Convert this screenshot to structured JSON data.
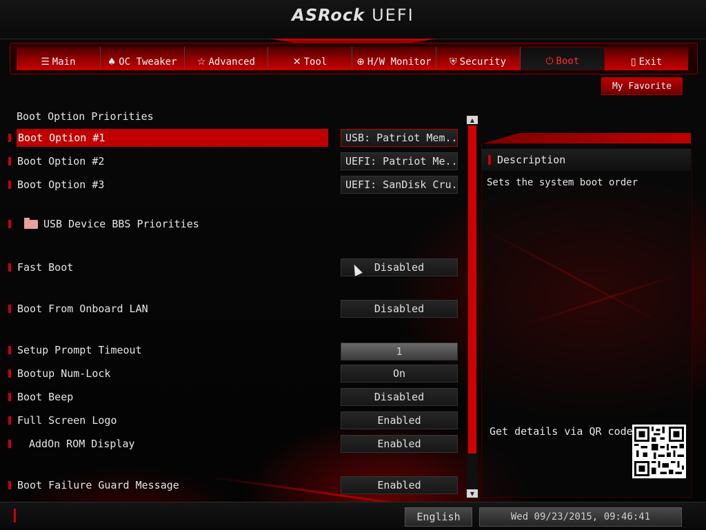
{
  "header": {
    "brand": "ASRock",
    "product": "UEFI"
  },
  "nav": {
    "tabs": [
      {
        "label": "Main",
        "icon": "list-icon",
        "glyph": "☰"
      },
      {
        "label": "OC Tweaker",
        "icon": "rocket-icon",
        "glyph": "♠"
      },
      {
        "label": "Advanced",
        "icon": "star-icon",
        "glyph": "☆"
      },
      {
        "label": "Tool",
        "icon": "tools-icon",
        "glyph": "✕"
      },
      {
        "label": "H/W Monitor",
        "icon": "crosshair-icon",
        "glyph": "⊕"
      },
      {
        "label": "Security",
        "icon": "shield-icon",
        "glyph": "⛨"
      },
      {
        "label": "Boot",
        "icon": "power-icon",
        "glyph": "⏻",
        "active": true
      },
      {
        "label": "Exit",
        "icon": "door-icon",
        "glyph": "▯"
      }
    ],
    "favorite": "My Favorite"
  },
  "main": {
    "section_title": "Boot Option Priorities",
    "options": [
      {
        "label": "Boot Option #1",
        "value": "USB:  Patriot Mem..."
      },
      {
        "label": "Boot Option #2",
        "value": "UEFI:  Patriot Me..."
      },
      {
        "label": "Boot Option #3",
        "value": "UEFI: SanDisk Cru..."
      },
      {
        "label": "USB Device BBS Priorities",
        "value": ""
      },
      {
        "label": "Fast Boot",
        "value": "Disabled"
      },
      {
        "label": "Boot From Onboard LAN",
        "value": "Disabled"
      },
      {
        "label": "Setup Prompt Timeout",
        "value": "1"
      },
      {
        "label": "Bootup Num-Lock",
        "value": "On"
      },
      {
        "label": "Boot Beep",
        "value": "Disabled"
      },
      {
        "label": "Full Screen Logo",
        "value": "Enabled"
      },
      {
        "label": "AddOn ROM Display",
        "value": "Enabled"
      },
      {
        "label": "Boot Failure Guard Message",
        "value": "Enabled"
      }
    ]
  },
  "description": {
    "title": "Description",
    "text": "Sets the system boot order",
    "qr_label": "Get details via QR code"
  },
  "footer": {
    "language": "English",
    "datetime": "Wed 09/23/2015, 09:46:41"
  },
  "colors": {
    "accent": "#c00000",
    "background": "#050505",
    "text": "#e6e6e6"
  }
}
